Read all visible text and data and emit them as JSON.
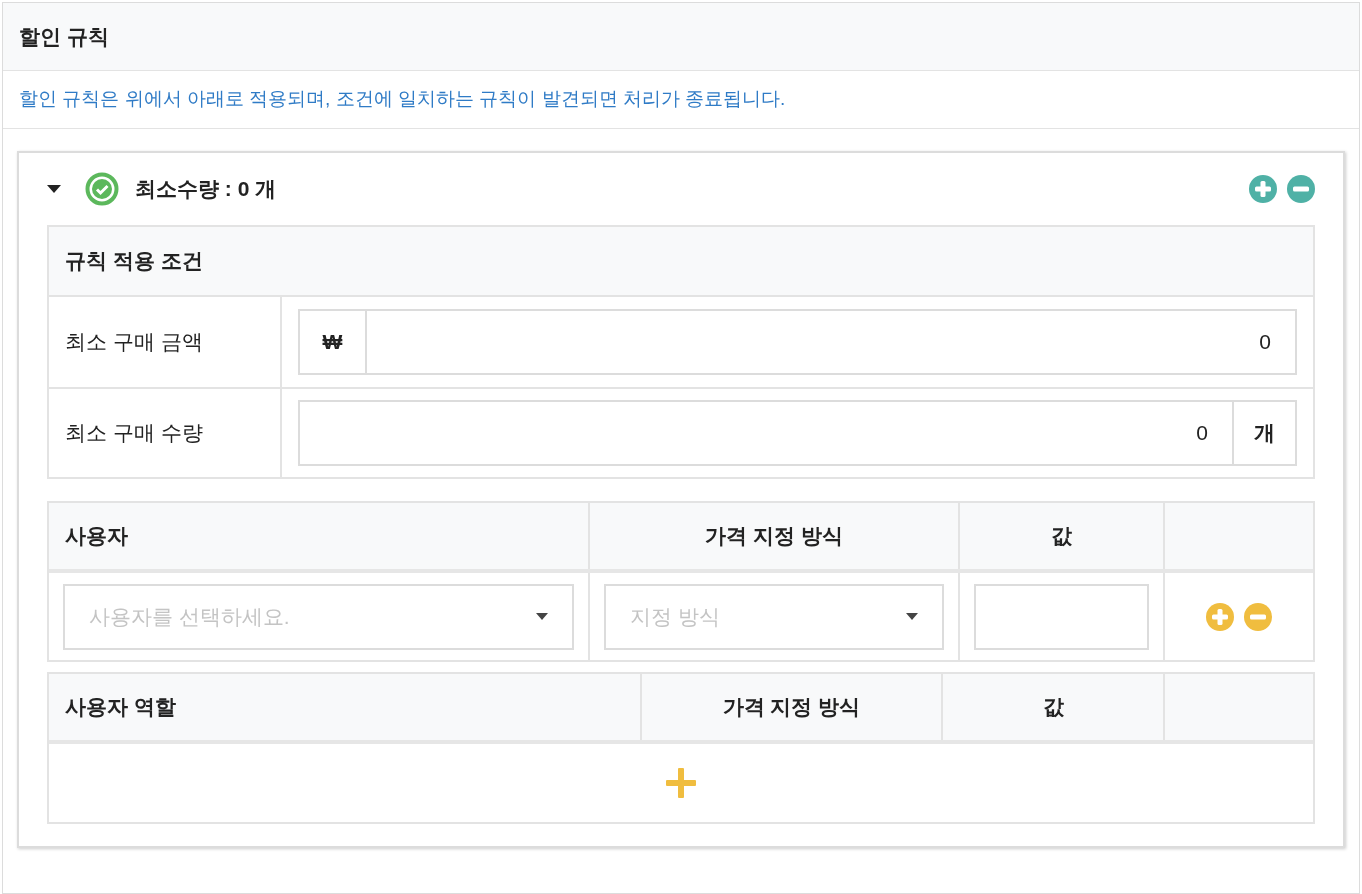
{
  "panel": {
    "title": "할인 규칙"
  },
  "notice": "할인 규칙은 위에서 아래로 적용되며, 조건에 일치하는 규칙이 발견되면 처리가 종료됩니다.",
  "rules": [
    {
      "title": "최소수량 : 0 개",
      "expanded": true,
      "enabled": true,
      "conditions": {
        "title": "규칙 적용 조건",
        "rows": [
          {
            "label": "최소 구매 금액",
            "kind": "prefix",
            "addon": "₩",
            "value": "0"
          },
          {
            "label": "최소 구매 수량",
            "kind": "suffix",
            "addon": "개",
            "value": "0"
          }
        ]
      },
      "tables": [
        {
          "columns": [
            "사용자",
            "가격 지정 방식",
            "값"
          ],
          "rows": [
            {
              "select_placeholder": "사용자를 선택하세요.",
              "method_placeholder": "지정 방식"
            }
          ]
        },
        {
          "columns": [
            "사용자 역할",
            "가격 지정 방식",
            "값"
          ]
        }
      ]
    }
  ]
}
